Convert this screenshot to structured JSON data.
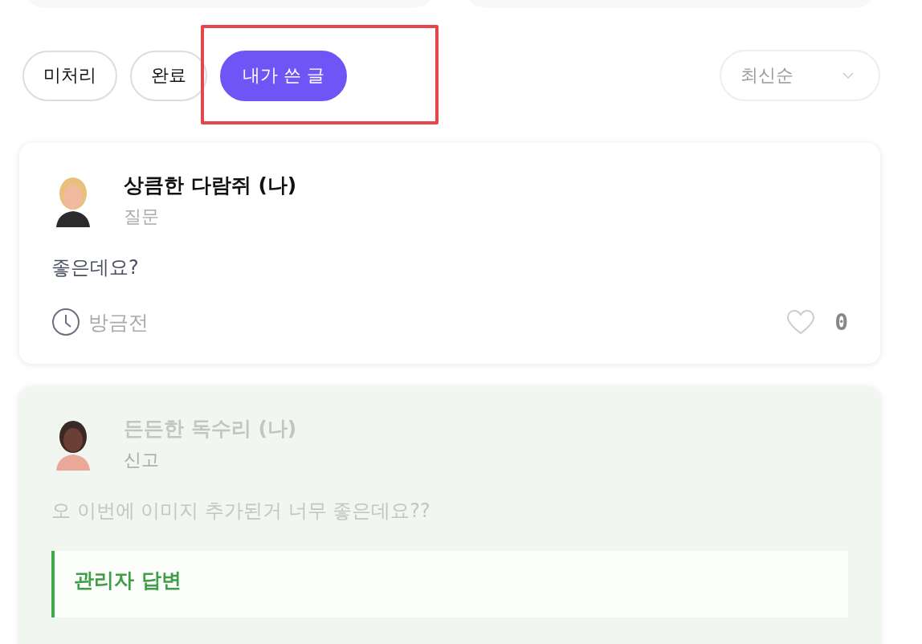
{
  "filters": [
    {
      "label": "미처리",
      "selected": false,
      "highlighted": false
    },
    {
      "label": "완료",
      "selected": false,
      "highlighted": false
    },
    {
      "label": "내가 쓴 글",
      "selected": true,
      "highlighted": true
    }
  ],
  "sort": {
    "value": "최신순"
  },
  "posts": [
    {
      "author": "상큼한 다람쥐 (나)",
      "category": "질문",
      "body": "좋은데요?",
      "time": "방금전",
      "likes": "0",
      "liked": false,
      "resolved": false,
      "color": "#f0b9a0"
    },
    {
      "author": "든든한 독수리 (나)",
      "category": "신고",
      "body": "오 이번에 이미지 추가된거 너무 좋은데요??",
      "resolved": true,
      "color": "#6b3f35",
      "reply": {
        "title": "관리자 답변"
      }
    }
  ]
}
